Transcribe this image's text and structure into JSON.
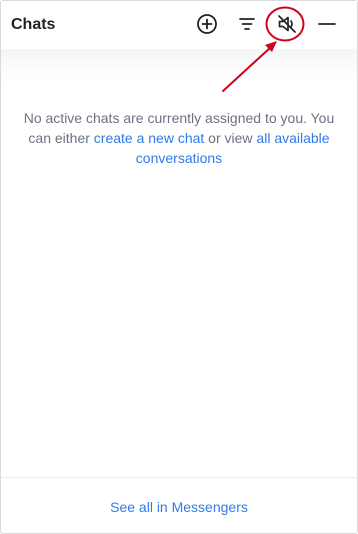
{
  "header": {
    "title": "Chats",
    "icons": {
      "add": "add-circle-icon",
      "filter": "filter-icon",
      "mute": "speaker-muted-icon",
      "minimize": "minimize-icon"
    }
  },
  "empty_state": {
    "text_part1": "No active chats are currently assigned to you. You can either ",
    "link_new_chat": "create a new chat",
    "text_part2": " or view ",
    "link_all_conversations": "all available conversations"
  },
  "footer": {
    "link_label": "See all in Messengers"
  },
  "colors": {
    "link": "#2f7be8",
    "annotation": "#d0021b",
    "text_muted": "#6b7280",
    "title": "#1f2329"
  }
}
